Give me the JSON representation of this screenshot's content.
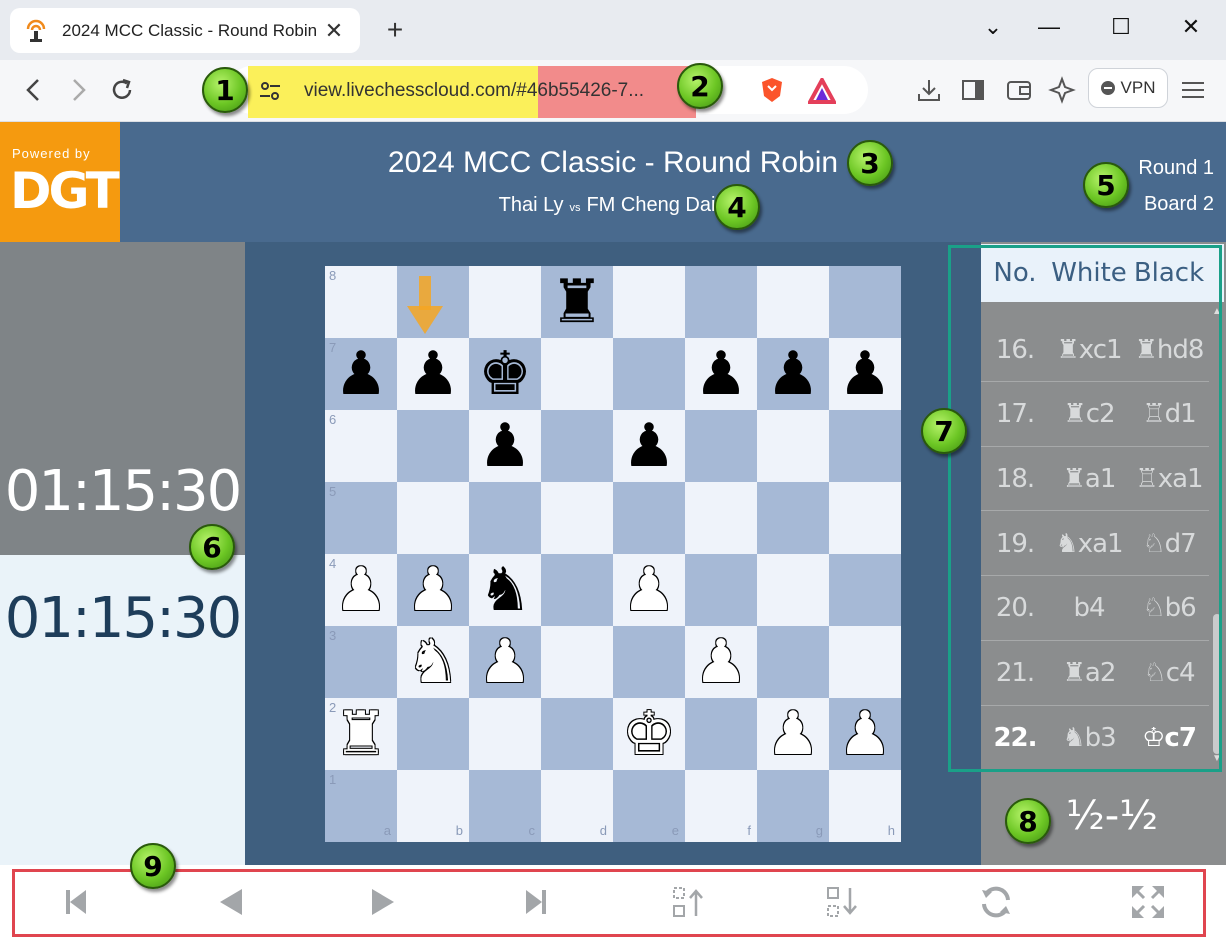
{
  "browser": {
    "tab_title": "2024 MCC Classic - Round Robin",
    "tab_close": "✕",
    "new_tab": "+",
    "url": "view.livechesscloud.com/#46b55426-7...",
    "vpn_label": "VPN",
    "win_controls": {
      "dropdown": "⌄",
      "minimize": "—",
      "maximize": "☐",
      "close": "✕"
    }
  },
  "logo": {
    "powered_by": "Powered by",
    "brand": "DGT"
  },
  "header": {
    "event_title": "2024 MCC Classic - Round Robin",
    "white_player": "Thai Ly",
    "vs": "vs",
    "black_player": "FM Cheng Dai",
    "round": "Round 1",
    "board": "Board 2"
  },
  "clocks": {
    "top": "01:15:30",
    "bottom": "01:15:30"
  },
  "board": {
    "files": [
      "a",
      "b",
      "c",
      "d",
      "e",
      "f",
      "g",
      "h"
    ],
    "ranks": [
      "8",
      "7",
      "6",
      "5",
      "4",
      "3",
      "2",
      "1"
    ],
    "position": [
      [
        "",
        "",
        "",
        "r",
        "",
        "",
        "",
        ""
      ],
      [
        "p",
        "p",
        "k",
        "",
        "",
        "p",
        "p",
        "p"
      ],
      [
        "",
        "",
        "p",
        "",
        "p",
        "",
        "",
        ""
      ],
      [
        "",
        "",
        "",
        "",
        "",
        "",
        "",
        ""
      ],
      [
        "P",
        "P",
        "n",
        "",
        "P",
        "",
        "",
        ""
      ],
      [
        "",
        "N",
        "P",
        "",
        "",
        "P",
        "",
        ""
      ],
      [
        "R",
        "",
        "",
        "",
        "K",
        "",
        "P",
        "P"
      ],
      [
        "",
        "",
        "",
        "",
        "",
        "",
        "",
        ""
      ]
    ],
    "highlight_color": "#f5a623"
  },
  "moves": {
    "headers": {
      "no": "No.",
      "white": "White",
      "black": "Black"
    },
    "rows": [
      {
        "no": "16.",
        "white": "♜xc1",
        "black": "♜hd8"
      },
      {
        "no": "17.",
        "white": "♜c2",
        "black": "♖d1"
      },
      {
        "no": "18.",
        "white": "♜a1",
        "black": "♖xa1"
      },
      {
        "no": "19.",
        "white": "♞xa1",
        "black": "♘d7"
      },
      {
        "no": "20.",
        "white": "b4",
        "black": "♘b6"
      },
      {
        "no": "21.",
        "white": "♜a2",
        "black": "♘c4"
      },
      {
        "no": "22.",
        "white": "♞b3",
        "black": "♔c7"
      }
    ],
    "result": "½-½"
  },
  "controls": [
    "first-move",
    "previous-move",
    "next-move",
    "last-move",
    "move-up",
    "move-down",
    "flip-board",
    "fullscreen"
  ],
  "badges": [
    "1",
    "2",
    "3",
    "4",
    "5",
    "6",
    "7",
    "8",
    "9"
  ],
  "colors": {
    "header_bg": "#496a8e",
    "logo_bg": "#f59a0f",
    "board_light": "#eff3fa",
    "board_dark": "#a6b9d6",
    "moves_frame": "#1aa088",
    "controls_frame": "#e0454f"
  }
}
